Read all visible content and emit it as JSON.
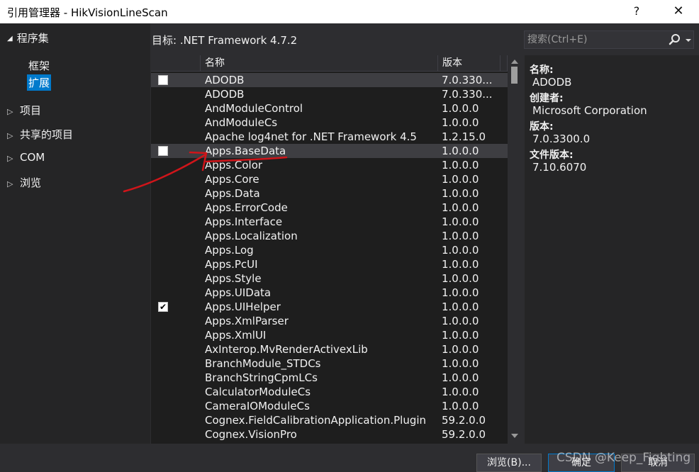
{
  "window": {
    "title": "引用管理器 - HikVisionLineScan",
    "help_label": "?",
    "close_label": "✕"
  },
  "sidebar": {
    "header": "程序集",
    "sub_items": [
      "框架",
      "扩展"
    ],
    "selected_sub_item": "扩展",
    "tree_items": [
      "项目",
      "共享的项目",
      "COM",
      "浏览"
    ]
  },
  "target_framework": "目标: .NET Framework 4.7.2",
  "search": {
    "placeholder": "搜索(Ctrl+E)"
  },
  "table": {
    "columns": [
      "名称",
      "版本"
    ],
    "rows": [
      {
        "name": "ADODB",
        "version": "7.0.330...",
        "checkbox": "unchecked",
        "selected": true
      },
      {
        "name": "ADODB",
        "version": "7.0.330...",
        "checkbox": "none",
        "selected": false
      },
      {
        "name": "AndModuleControl",
        "version": "1.0.0.0",
        "checkbox": "none",
        "selected": false
      },
      {
        "name": "AndModuleCs",
        "version": "1.0.0.0",
        "checkbox": "none",
        "selected": false
      },
      {
        "name": "Apache log4net for .NET Framework 4.5",
        "version": "1.2.15.0",
        "checkbox": "none",
        "selected": false
      },
      {
        "name": "Apps.BaseData",
        "version": "1.0.0.0",
        "checkbox": "unchecked",
        "selected": true
      },
      {
        "name": "Apps.Color",
        "version": "1.0.0.0",
        "checkbox": "none",
        "selected": false
      },
      {
        "name": "Apps.Core",
        "version": "1.0.0.0",
        "checkbox": "none",
        "selected": false
      },
      {
        "name": "Apps.Data",
        "version": "1.0.0.0",
        "checkbox": "none",
        "selected": false
      },
      {
        "name": "Apps.ErrorCode",
        "version": "1.0.0.0",
        "checkbox": "none",
        "selected": false
      },
      {
        "name": "Apps.Interface",
        "version": "1.0.0.0",
        "checkbox": "none",
        "selected": false
      },
      {
        "name": "Apps.Localization",
        "version": "1.0.0.0",
        "checkbox": "none",
        "selected": false
      },
      {
        "name": "Apps.Log",
        "version": "1.0.0.0",
        "checkbox": "none",
        "selected": false
      },
      {
        "name": "Apps.PcUI",
        "version": "1.0.0.0",
        "checkbox": "none",
        "selected": false
      },
      {
        "name": "Apps.Style",
        "version": "1.0.0.0",
        "checkbox": "none",
        "selected": false
      },
      {
        "name": "Apps.UIData",
        "version": "1.0.0.0",
        "checkbox": "none",
        "selected": false
      },
      {
        "name": "Apps.UIHelper",
        "version": "1.0.0.0",
        "checkbox": "checked",
        "selected": false
      },
      {
        "name": "Apps.XmlParser",
        "version": "1.0.0.0",
        "checkbox": "none",
        "selected": false
      },
      {
        "name": "Apps.XmlUI",
        "version": "1.0.0.0",
        "checkbox": "none",
        "selected": false
      },
      {
        "name": "AxInterop.MvRenderActivexLib",
        "version": "1.0.0.0",
        "checkbox": "none",
        "selected": false
      },
      {
        "name": "BranchModule_STDCs",
        "version": "1.0.0.0",
        "checkbox": "none",
        "selected": false
      },
      {
        "name": "BranchStringCpmLCs",
        "version": "1.0.0.0",
        "checkbox": "none",
        "selected": false
      },
      {
        "name": "CalculatorModuleCs",
        "version": "1.0.0.0",
        "checkbox": "none",
        "selected": false
      },
      {
        "name": "CameraIOModuleCs",
        "version": "1.0.0.0",
        "checkbox": "none",
        "selected": false
      },
      {
        "name": "Cognex.FieldCalibrationApplication.Plugin",
        "version": "59.2.0.0",
        "checkbox": "none",
        "selected": false
      },
      {
        "name": "Cognex.VisionPro",
        "version": "59.2.0.0",
        "checkbox": "none",
        "selected": false
      }
    ]
  },
  "details": {
    "name_label": "名称:",
    "name_value": "ADODB",
    "creator_label": "创建者:",
    "creator_value": "Microsoft Corporation",
    "version_label": "版本:",
    "version_value": "7.0.3300.0",
    "file_version_label": "文件版本:",
    "file_version_value": "7.10.6070"
  },
  "footer": {
    "browse_label": "浏览(B)...",
    "ok_label": "确定",
    "cancel_label": "取消"
  },
  "watermark": "CSDN @Keep_Fighting",
  "colors": {
    "background": "#2d2d30",
    "grid_background": "#1e1e1e",
    "accent": "#007acc",
    "annotation": "#d0151a"
  },
  "icons": {
    "search": "search-icon",
    "expand": "chevron-right-icon",
    "collapse": "triangle-down-icon",
    "check": "checkmark-icon"
  }
}
